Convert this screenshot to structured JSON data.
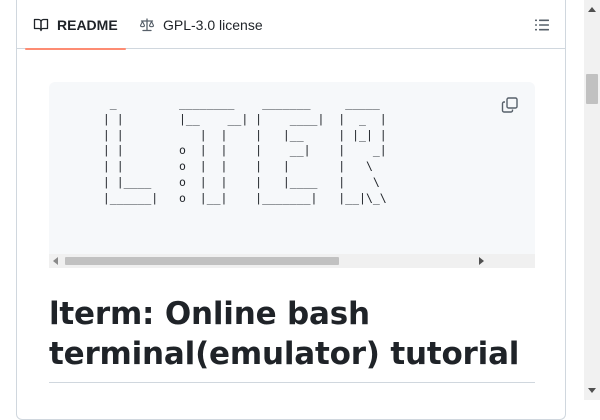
{
  "tabs": {
    "readme_label": "README",
    "license_label": "GPL-3.0 license"
  },
  "icons": {
    "readme": "book-icon",
    "license": "scale-icon",
    "menu": "list-unordered-icon",
    "copy": "copy-icon"
  },
  "code_block": {
    "ascii_art": "   _         ________    _______     _____\n  | |        |__    __| |    ____|  |  _  |\n  | |           |  |    |   |__     | |_| |\n  | |        o  |  |    |    __|    |    _|\n  | |        o  |  |    |   |       |   \\\n  | |____    o  |  |    |   |____   |    \\\n  |______|   o  |__|    |_______|   |__|\\_\\"
  },
  "article": {
    "heading": "lterm: Online bash terminal(emulator) tutorial"
  },
  "colors": {
    "accent_underline": "#fd8c73",
    "border": "#d0d7de",
    "code_bg": "#f6f8fa"
  }
}
